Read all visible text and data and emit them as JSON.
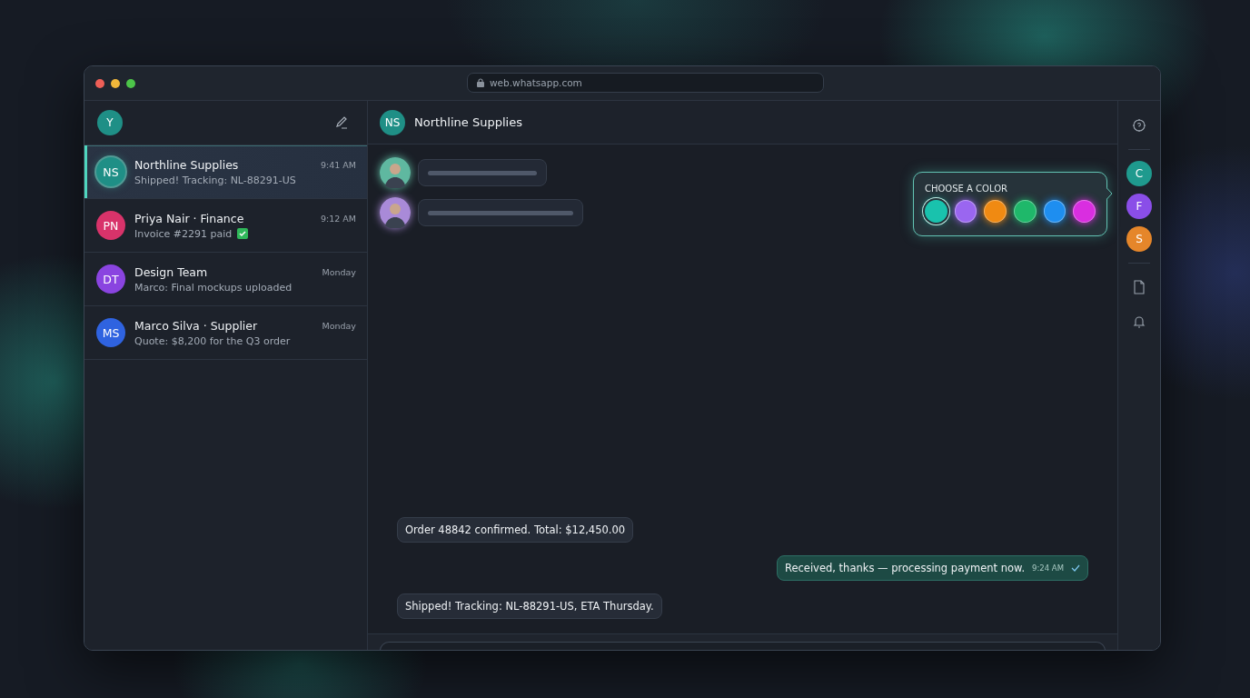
{
  "window": {
    "url": "web.whatsapp.com"
  },
  "sidebar": {
    "profile": {
      "initial": "Y",
      "color": "#1f8f86"
    },
    "chats": [
      {
        "initials": "NS",
        "name": "Northline Supplies",
        "preview": "Shipped! Tracking: NL-88291-US",
        "time": "9:41 AM",
        "selected": true,
        "checked": false,
        "color": "#1f8f86"
      },
      {
        "initials": "PN",
        "name": "Priya Nair · Finance",
        "preview": "Invoice #2291 paid",
        "time": "9:12 AM",
        "selected": false,
        "checked": true,
        "color": "#d8336a"
      },
      {
        "initials": "DT",
        "name": "Design Team",
        "preview": "Marco: Final mockups uploaded",
        "time": "Monday",
        "selected": false,
        "checked": false,
        "color": "#8a44e0"
      },
      {
        "initials": "MS",
        "name": "Marco Silva · Supplier",
        "preview": "Quote: $8,200 for the Q3 order",
        "time": "Monday",
        "selected": false,
        "checked": false,
        "color": "#2f63e0"
      }
    ]
  },
  "chat": {
    "initials": "NS",
    "name": "Northline Supplies",
    "color": "#1f8f86",
    "placeholders": [
      {
        "color": "#5fb8a0"
      },
      {
        "color": "#a98ad8"
      }
    ],
    "messages": [
      {
        "kind": "incoming",
        "text": "Order 48842 confirmed. Total: $12,450.00"
      },
      {
        "kind": "outgoing",
        "text": "Received, thanks — processing payment now.",
        "time": "9:24 AM",
        "read": true
      },
      {
        "kind": "incoming",
        "text": "Shipped! Tracking: NL-88291-US, ETA Thursday."
      }
    ]
  },
  "color_picker": {
    "title": "CHOOSE A COLOR",
    "swatches": [
      {
        "color": "#19c2ad",
        "selected": true
      },
      {
        "color": "#9a66f0",
        "selected": false
      },
      {
        "color": "#f08a12",
        "selected": false
      },
      {
        "color": "#1fb86a",
        "selected": false
      },
      {
        "color": "#1e8ef0",
        "selected": false
      },
      {
        "color": "#d92ee0",
        "selected": false
      }
    ]
  },
  "rail": {
    "contacts": [
      {
        "initial": "C",
        "color": "#1f9a8e"
      },
      {
        "initial": "F",
        "color": "#8a4ee8"
      },
      {
        "initial": "S",
        "color": "#e5862a"
      }
    ]
  }
}
